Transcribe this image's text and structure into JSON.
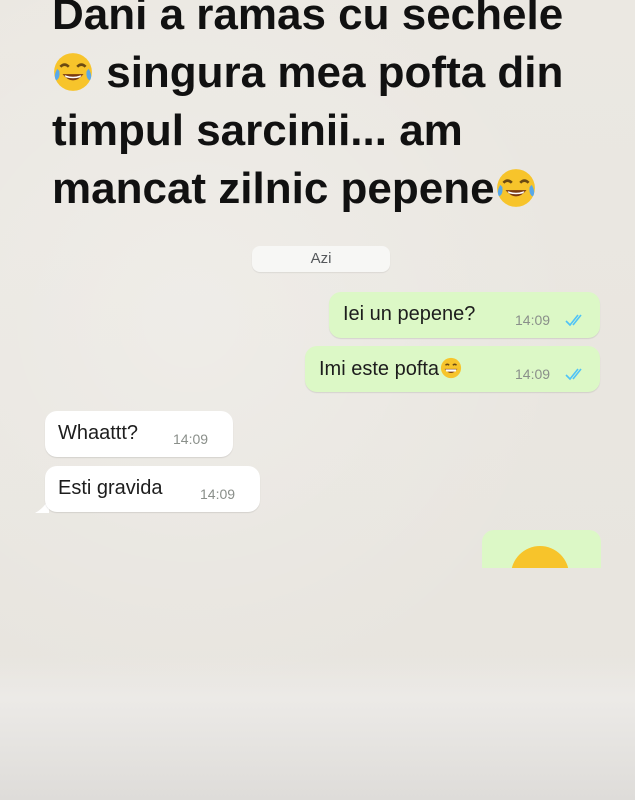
{
  "caption": {
    "line1": "Dani a ramas cu sechele",
    "line2": "singura mea pofta din",
    "line3": "timpul sarcinii... am",
    "line4": "mancat zilnic pepene"
  },
  "chat": {
    "date_label": "Azi",
    "messages": [
      {
        "direction": "outgoing",
        "text": "Iei un pepene?",
        "time": "14:09",
        "status": "read"
      },
      {
        "direction": "outgoing",
        "text": "Imi este pofta",
        "time": "14:09",
        "status": "read",
        "emoji": "grinning-face-with-smiling-eyes"
      },
      {
        "direction": "incoming",
        "text": "Whaattt?",
        "time": "14:09"
      },
      {
        "direction": "incoming",
        "text": "Esti gravida",
        "time": "14:09"
      },
      {
        "direction": "outgoing",
        "text": "",
        "emoji": "face-partially-visible"
      }
    ]
  },
  "colors": {
    "outgoing_bubble": "#dcf8c6",
    "incoming_bubble": "#ffffff",
    "read_ticks": "#4fc3f7",
    "caption_text": "#111111",
    "chat_background": "#e9e6e0"
  },
  "icons": {
    "caption_emoji": "face-with-tears-of-joy",
    "message_emoji": "grinning-face-with-smiling-eyes",
    "status": "double-check-icon"
  }
}
